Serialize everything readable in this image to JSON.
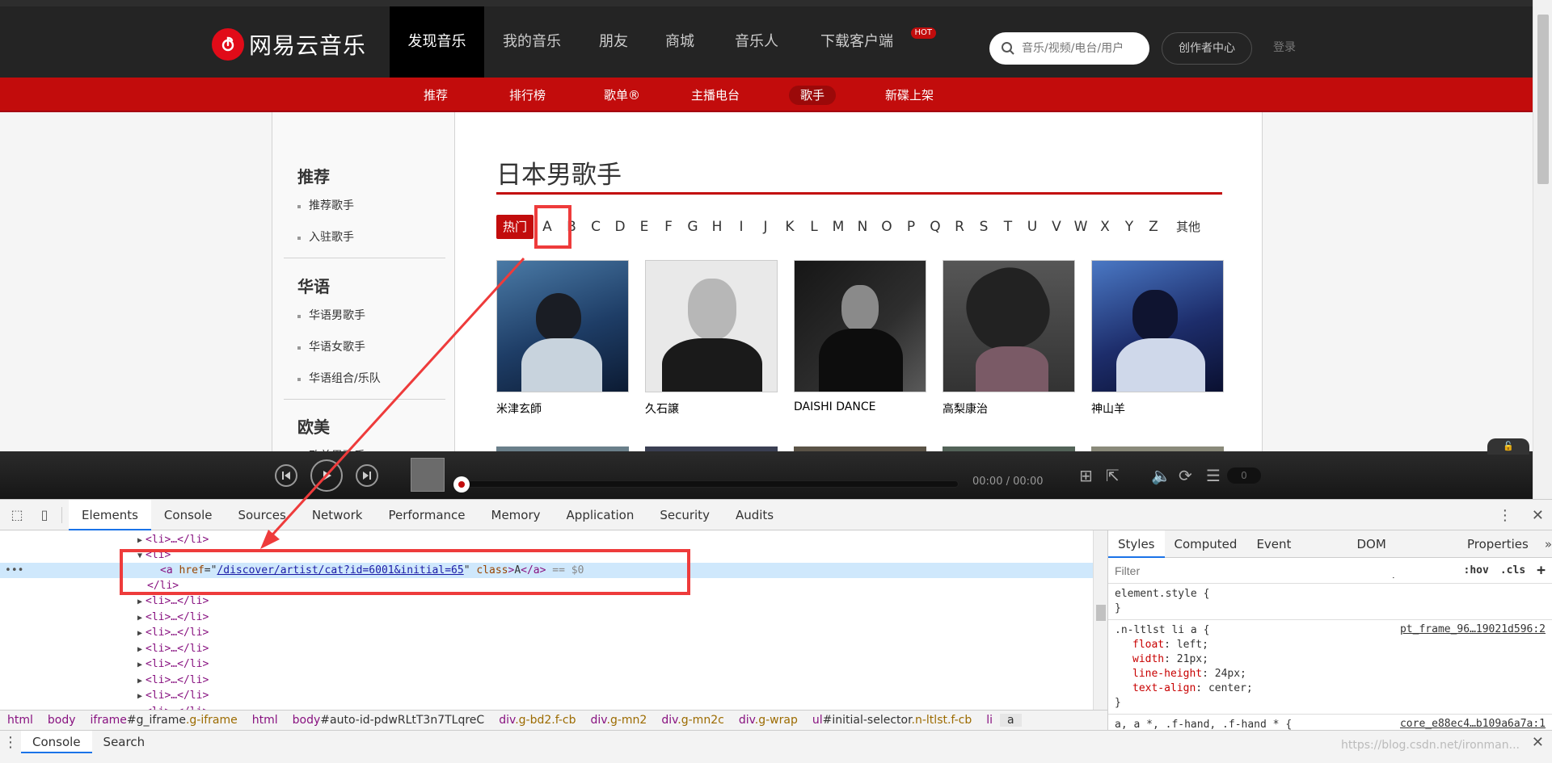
{
  "topnav": {
    "logo_text": "网易云音乐",
    "items": [
      {
        "label": "发现音乐",
        "active": true
      },
      {
        "label": "我的音乐"
      },
      {
        "label": "朋友"
      },
      {
        "label": "商城"
      },
      {
        "label": "音乐人"
      },
      {
        "label": "下载客户端",
        "badge": "HOT"
      }
    ],
    "search_placeholder": "音乐/视频/电台/用户",
    "creator_label": "创作者中心",
    "login_label": "登录"
  },
  "subnav": {
    "items": [
      {
        "label": "推荐"
      },
      {
        "label": "排行榜"
      },
      {
        "label": "歌单®"
      },
      {
        "label": "主播电台"
      },
      {
        "label": "歌手",
        "active": true
      },
      {
        "label": "新碟上架"
      }
    ]
  },
  "sidebar": {
    "groups": [
      {
        "title": "推荐",
        "links": [
          "推荐歌手",
          "入驻歌手"
        ]
      },
      {
        "title": "华语",
        "links": [
          "华语男歌手",
          "华语女歌手",
          "华语组合/乐队"
        ]
      },
      {
        "title": "欧美",
        "links": [
          "欧美男歌手"
        ]
      }
    ]
  },
  "main": {
    "title": "日本男歌手",
    "letters": [
      "热门",
      "A",
      "B",
      "C",
      "D",
      "E",
      "F",
      "G",
      "H",
      "I",
      "J",
      "K",
      "L",
      "M",
      "N",
      "O",
      "P",
      "Q",
      "R",
      "S",
      "T",
      "U",
      "V",
      "W",
      "X",
      "Y",
      "Z",
      "其他"
    ],
    "artists": [
      {
        "name": "米津玄師"
      },
      {
        "name": "久石譲"
      },
      {
        "name": "DAISHI DANCE"
      },
      {
        "name": "高梨康治"
      },
      {
        "name": "神山羊"
      }
    ]
  },
  "player": {
    "time": "00:00 / 00:00",
    "count": "0"
  },
  "devtools": {
    "tabs": [
      "Elements",
      "Console",
      "Sources",
      "Network",
      "Performance",
      "Memory",
      "Application",
      "Security",
      "Audits"
    ],
    "dom_lines": {
      "li_collapsed": "<li>…</li>",
      "li_open": "<li>",
      "a_tag_open": "<a ",
      "a_attr_href": "href",
      "a_href": "/discover/artist/cat?id=6001&initial=65",
      "a_attr_class": "class",
      "a_text": "A",
      "a_tag_close": "</a>",
      "a_marker": "== $0",
      "li_close": "</li>"
    },
    "breadcrumbs": [
      {
        "tag": "html"
      },
      {
        "tag": "body"
      },
      {
        "tag": "iframe",
        "id": "#g_iframe",
        "cls": ".g-iframe"
      },
      {
        "tag": "html"
      },
      {
        "tag": "body",
        "id": "#auto-id-pdwRLtT3n7TLqreC"
      },
      {
        "tag": "div",
        "cls": ".g-bd2.f-cb"
      },
      {
        "tag": "div",
        "cls": ".g-mn2"
      },
      {
        "tag": "div",
        "cls": ".g-mn2c"
      },
      {
        "tag": "div",
        "cls": ".g-wrap"
      },
      {
        "tag": "ul",
        "id": "#initial-selector",
        "cls": ".n-ltlst.f-cb"
      },
      {
        "tag": "li"
      },
      {
        "tag": "a",
        "selected": true
      }
    ],
    "styles_tabs": [
      "Styles",
      "Computed",
      "Event Listeners",
      "DOM Breakpoints",
      "Properties"
    ],
    "filter_placeholder": "Filter",
    "hov": ":hov",
    "cls": ".cls",
    "element_style": "element.style {",
    "rule_selector": ".n-ltlst li a {",
    "rule_source": "pt_frame_96…19021d596:2",
    "rule_props": [
      {
        "name": "float",
        "value": "left;"
      },
      {
        "name": "width",
        "value": "21px;"
      },
      {
        "name": "line-height",
        "value": "24px;"
      },
      {
        "name": "text-align",
        "value": "center;"
      }
    ],
    "rule2_selector": "a, a *, .f-hand, .f-hand * {",
    "rule2_source": "core_e88ec4…b109a6a7a:1",
    "drawer_tabs": [
      "Console",
      "Search"
    ],
    "watermark": "https://blog.csdn.net/ironman..."
  },
  "colors": {
    "brand": "#c20c0c",
    "topbar": "#242424",
    "annotation": "#ee3b3b"
  }
}
